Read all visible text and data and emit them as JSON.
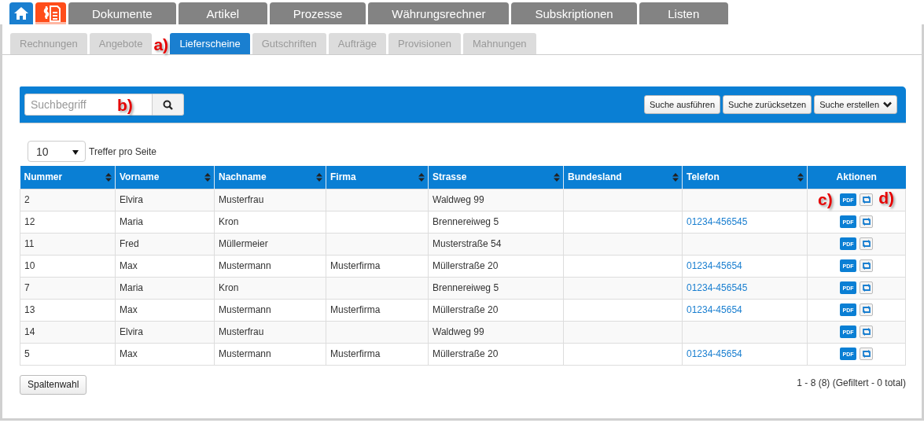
{
  "main_tabs": [
    {
      "kind": "home",
      "selected": false
    },
    {
      "kind": "invoice",
      "selected": true
    },
    {
      "kind": "text",
      "label": "Dokumente",
      "selected": false
    },
    {
      "kind": "text",
      "label": "Artikel",
      "selected": false
    },
    {
      "kind": "text",
      "label": "Prozesse",
      "selected": false
    },
    {
      "kind": "text",
      "label": "Währungsrechner",
      "selected": false
    },
    {
      "kind": "text",
      "label": "Subskriptionen",
      "selected": false
    },
    {
      "kind": "text",
      "label": "Listen",
      "selected": false
    }
  ],
  "sub_tabs": [
    {
      "label": "Rechnungen",
      "selected": false
    },
    {
      "label": "Angebote",
      "selected": false
    },
    {
      "label": "Lieferscheine",
      "selected": true,
      "callout": "a)"
    },
    {
      "label": "Gutschriften",
      "selected": false
    },
    {
      "label": "Aufträge",
      "selected": false
    },
    {
      "label": "Provisionen",
      "selected": false
    },
    {
      "label": "Mahnungen",
      "selected": false
    }
  ],
  "search": {
    "placeholder": "Suchbegriff",
    "callout": "b)",
    "buttons": [
      {
        "label": "Suche ausführen",
        "kind": "plain"
      },
      {
        "label": "Suche zurücksetzen",
        "kind": "plain"
      },
      {
        "label": "Suche erstellen",
        "kind": "dropdown"
      }
    ]
  },
  "page_size": {
    "value": "10",
    "label": "Treffer pro Seite"
  },
  "table": {
    "columns": [
      "Nummer",
      "Vorname",
      "Nachname",
      "Firma",
      "Strasse",
      "Bundesland",
      "Telefon",
      "Aktionen"
    ],
    "rows": [
      {
        "cells": [
          "2",
          "Elvira",
          "Musterfrau",
          "",
          "Waldweg 99",
          "",
          ""
        ],
        "pdf": "PDF",
        "callout_left": "c)",
        "callout_right": "d)"
      },
      {
        "cells": [
          "12",
          "Maria",
          "Kron",
          "",
          "Brennereiweg 5",
          "",
          "01234-456545"
        ],
        "pdf": "PDF"
      },
      {
        "cells": [
          "11",
          "Fred",
          "Müllermeier",
          "",
          "Musterstraße 54",
          "",
          ""
        ],
        "pdf": "PDF"
      },
      {
        "cells": [
          "10",
          "Max",
          "Mustermann",
          "Musterfirma",
          "Müllerstraße 20",
          "",
          "01234-45654"
        ],
        "pdf": "PDF"
      },
      {
        "cells": [
          "7",
          "Maria",
          "Kron",
          "",
          "Brennereiweg 5",
          "",
          "01234-456545"
        ],
        "pdf": "PDF"
      },
      {
        "cells": [
          "13",
          "Max",
          "Mustermann",
          "Musterfirma",
          "Müllerstraße 20",
          "",
          "01234-45654"
        ],
        "pdf": "PDF"
      },
      {
        "cells": [
          "14",
          "Elvira",
          "Musterfrau",
          "",
          "Waldweg 99",
          "",
          ""
        ],
        "pdf": "PDF"
      },
      {
        "cells": [
          "5",
          "Max",
          "Mustermann",
          "Musterfirma",
          "Müllerstraße 20",
          "",
          "01234-45654"
        ],
        "pdf": "PDF"
      }
    ]
  },
  "columns_button": "Spaltenwahl",
  "summary": "1 - 8 (8) (Gefiltert - 0 total)"
}
